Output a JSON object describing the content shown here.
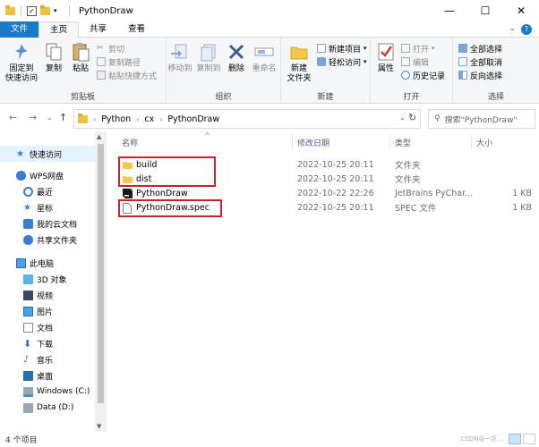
{
  "window": {
    "title": "PythonDraw",
    "minimize_glyph": "—",
    "maximize_glyph": "☐",
    "close_glyph": "✕"
  },
  "ribbon_tabs": [
    {
      "label": "文件"
    },
    {
      "label": "主页"
    },
    {
      "label": "共享"
    },
    {
      "label": "查看"
    }
  ],
  "ribbon": {
    "clipboard": {
      "label": "剪贴板",
      "pin": "固定到\n快速访问",
      "copy": "复制",
      "paste": "粘贴",
      "cut": "剪切",
      "copy_path": "复制路径",
      "paste_shortcut": "粘贴快捷方式"
    },
    "organize": {
      "label": "组织",
      "move_to": "移动到",
      "copy_to": "复制到",
      "delete": "删除",
      "rename": "重命名"
    },
    "new": {
      "label": "新建",
      "new_folder": "新建\n文件夹",
      "new_item": "新建项目",
      "easy_access": "轻松访问"
    },
    "open": {
      "label": "打开",
      "properties": "属性",
      "open": "打开",
      "edit": "编辑",
      "history": "历史记录"
    },
    "select": {
      "label": "选择",
      "select_all": "全部选择",
      "select_none": "全部取消",
      "invert": "反向选择"
    }
  },
  "address": {
    "crumbs": [
      "Python",
      "cx",
      "PythonDraw"
    ],
    "search_placeholder": "搜索\"PythonDraw\""
  },
  "nav": {
    "items": [
      {
        "label": "快速访问",
        "icon": "star-icon"
      },
      {
        "label": "WPS网盘",
        "icon": "cloud-icon"
      },
      {
        "label": "最近",
        "icon": "clock-icon"
      },
      {
        "label": "星标",
        "icon": "star-icon"
      },
      {
        "label": "我的云文档",
        "icon": "cloud-doc-icon"
      },
      {
        "label": "共享文件夹",
        "icon": "shared-folder-icon"
      },
      {
        "label": "此电脑",
        "icon": "pc-icon"
      },
      {
        "label": "3D 对象",
        "icon": "cube-icon"
      },
      {
        "label": "视频",
        "icon": "video-icon"
      },
      {
        "label": "图片",
        "icon": "picture-icon"
      },
      {
        "label": "文档",
        "icon": "document-icon"
      },
      {
        "label": "下载",
        "icon": "download-icon"
      },
      {
        "label": "音乐",
        "icon": "music-icon"
      },
      {
        "label": "桌面",
        "icon": "desktop-icon"
      },
      {
        "label": "Windows (C:)",
        "icon": "drive-icon"
      },
      {
        "label": "Data (D:)",
        "icon": "drive-icon"
      }
    ]
  },
  "filelist": {
    "columns": {
      "name": "名称",
      "date": "修改日期",
      "type": "类型",
      "size": "大小"
    },
    "rows": [
      {
        "name": "build",
        "date": "2022-10-25 20:11",
        "type": "文件夹",
        "size": "",
        "icon": "folder-icon"
      },
      {
        "name": "dist",
        "date": "2022-10-25 20:11",
        "type": "文件夹",
        "size": "",
        "icon": "folder-icon"
      },
      {
        "name": "PythonDraw",
        "date": "2022-10-22 22:26",
        "type": "JetBrains PyChar...",
        "size": "1 KB",
        "icon": "pycharm-file-icon"
      },
      {
        "name": "PythonDraw.spec",
        "date": "2022-10-25 20:11",
        "type": "SPEC 文件",
        "size": "1 KB",
        "icon": "spec-file-icon"
      }
    ]
  },
  "status": {
    "count": "4 个项目",
    "watermark": "CSDN@一区..."
  },
  "colors": {
    "file_tab": "#1979ca",
    "highlight": "#c0262a",
    "selected_nav": "#e5f3ff"
  }
}
